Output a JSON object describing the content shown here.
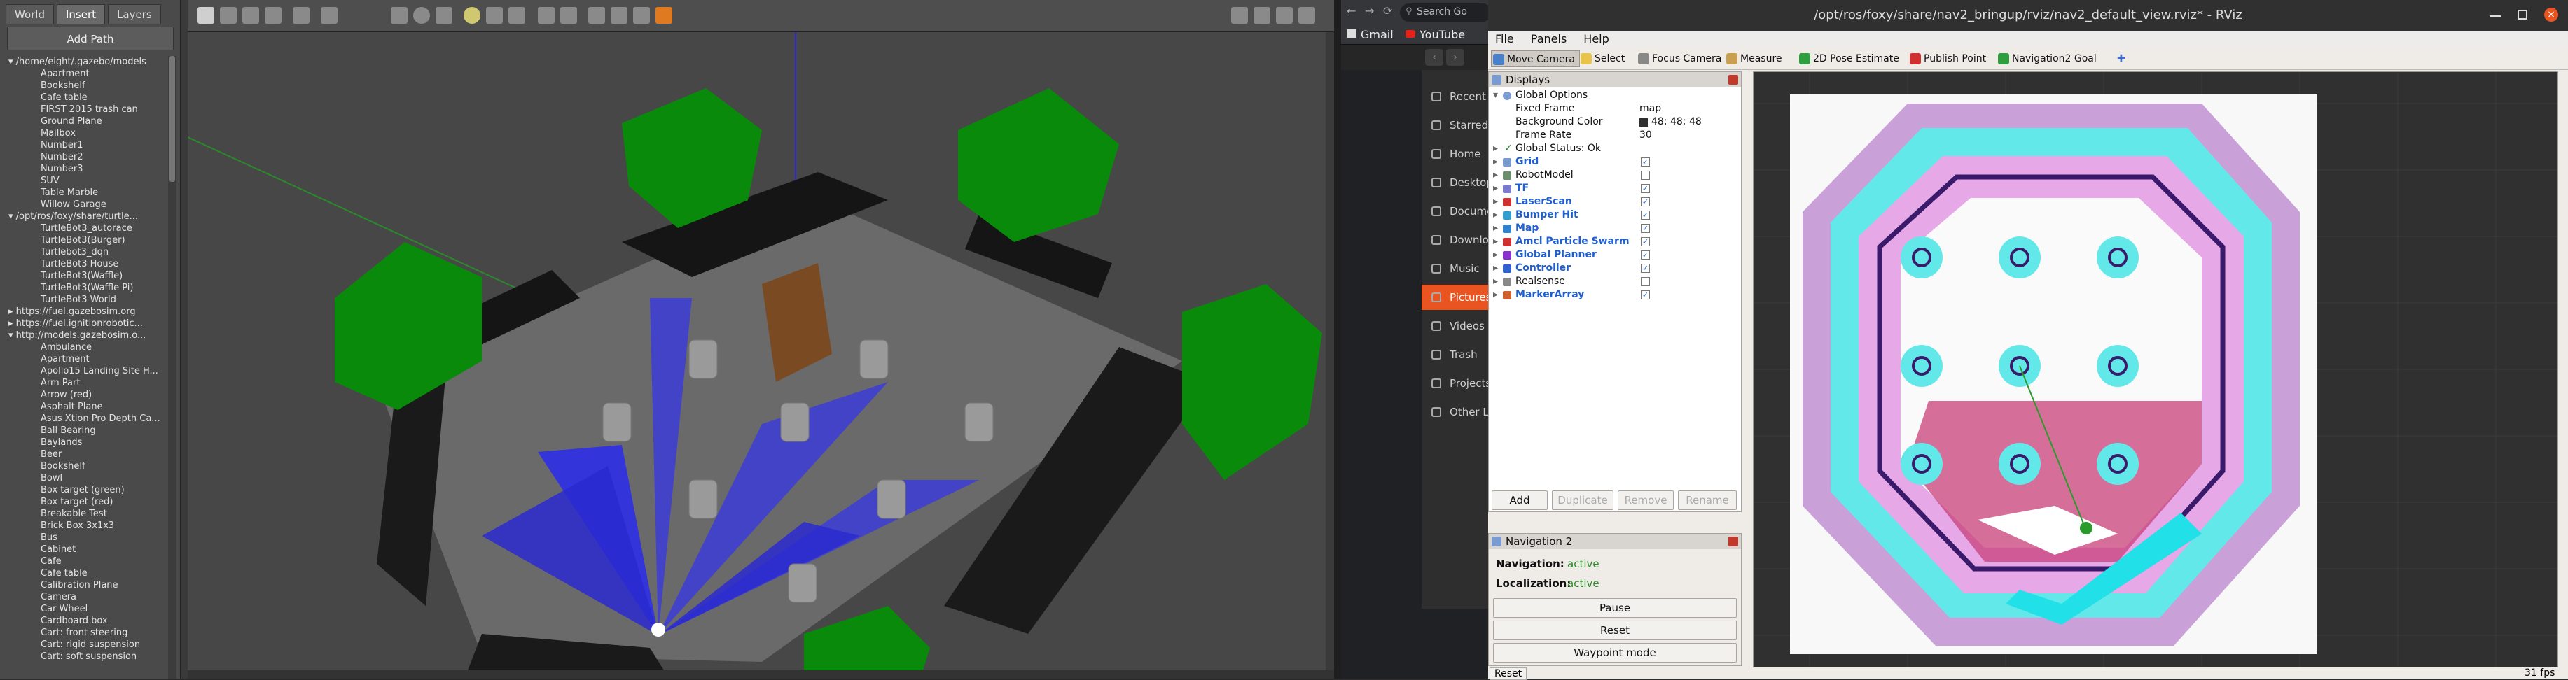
{
  "gazebo": {
    "tabs": [
      "World",
      "Insert",
      "Layers"
    ],
    "add_path": "Add Path",
    "tree": [
      {
        "label": "/home/eight/.gazebo/models",
        "level": 0,
        "expanded": true
      },
      {
        "label": "Apartment",
        "level": 1
      },
      {
        "label": "Bookshelf",
        "level": 1
      },
      {
        "label": "Cafe table",
        "level": 1
      },
      {
        "label": "FIRST 2015 trash can",
        "level": 1
      },
      {
        "label": "Ground Plane",
        "level": 1
      },
      {
        "label": "Mailbox",
        "level": 1
      },
      {
        "label": "Number1",
        "level": 1
      },
      {
        "label": "Number2",
        "level": 1
      },
      {
        "label": "Number3",
        "level": 1
      },
      {
        "label": "SUV",
        "level": 1
      },
      {
        "label": "Table Marble",
        "level": 1
      },
      {
        "label": "Willow Garage",
        "level": 1
      },
      {
        "label": "/opt/ros/foxy/share/turtle...",
        "level": 0,
        "expanded": true
      },
      {
        "label": "TurtleBot3_autorace",
        "level": 1
      },
      {
        "label": "TurtleBot3(Burger)",
        "level": 1
      },
      {
        "label": "Turtlebot3_dqn",
        "level": 1
      },
      {
        "label": "TurtleBot3 House",
        "level": 1
      },
      {
        "label": "TurtleBot3(Waffle)",
        "level": 1
      },
      {
        "label": "TurtleBot3(Waffle Pi)",
        "level": 1
      },
      {
        "label": "TurtleBot3 World",
        "level": 1
      },
      {
        "label": "https://fuel.gazebosim.org",
        "level": 0,
        "expanded": false
      },
      {
        "label": "https://fuel.ignitionrobotic...",
        "level": 0,
        "expanded": false
      },
      {
        "label": "http://models.gazebosim.o...",
        "level": 0,
        "expanded": true
      },
      {
        "label": "Ambulance",
        "level": 1
      },
      {
        "label": "Apartment",
        "level": 1
      },
      {
        "label": "Apollo15 Landing Site H...",
        "level": 1
      },
      {
        "label": "Arm Part",
        "level": 1
      },
      {
        "label": "Arrow (red)",
        "level": 1
      },
      {
        "label": "Asphalt Plane",
        "level": 1
      },
      {
        "label": "Asus Xtion Pro Depth Ca...",
        "level": 1
      },
      {
        "label": "Ball Bearing",
        "level": 1
      },
      {
        "label": "Baylands",
        "level": 1
      },
      {
        "label": "Beer",
        "level": 1
      },
      {
        "label": "Bookshelf",
        "level": 1
      },
      {
        "label": "Bowl",
        "level": 1
      },
      {
        "label": "Box target (green)",
        "level": 1
      },
      {
        "label": "Box target (red)",
        "level": 1
      },
      {
        "label": "Breakable Test",
        "level": 1
      },
      {
        "label": "Brick Box 3x1x3",
        "level": 1
      },
      {
        "label": "Bus",
        "level": 1
      },
      {
        "label": "Cabinet",
        "level": 1
      },
      {
        "label": "Cafe",
        "level": 1
      },
      {
        "label": "Cafe table",
        "level": 1
      },
      {
        "label": "Calibration Plane",
        "level": 1
      },
      {
        "label": "Camera",
        "level": 1
      },
      {
        "label": "Car Wheel",
        "level": 1
      },
      {
        "label": "Cardboard box",
        "level": 1
      },
      {
        "label": "Cart: front steering",
        "level": 1
      },
      {
        "label": "Cart: rigid suspension",
        "level": 1
      },
      {
        "label": "Cart: soft suspension",
        "level": 1
      }
    ]
  },
  "browser": {
    "address": "Search Go",
    "bookmarks": [
      "Gmail",
      "YouTube"
    ],
    "sidebar": [
      {
        "label": "Recent",
        "selected": false
      },
      {
        "label": "Starred",
        "selected": false
      },
      {
        "label": "Home",
        "selected": false
      },
      {
        "label": "Desktop",
        "selected": false
      },
      {
        "label": "Documents",
        "selected": false
      },
      {
        "label": "Downloads",
        "selected": false
      },
      {
        "label": "Music",
        "selected": false
      },
      {
        "label": "Pictures",
        "selected": true
      },
      {
        "label": "Videos",
        "selected": false
      },
      {
        "label": "Trash",
        "selected": false
      },
      {
        "label": "Projects",
        "selected": false
      },
      {
        "label": "Other Locations",
        "selected": false
      }
    ]
  },
  "rviz": {
    "title": "/opt/ros/foxy/share/nav2_bringup/rviz/nav2_default_view.rviz* - RViz",
    "menu": [
      "File",
      "Panels",
      "Help"
    ],
    "tools": [
      {
        "label": "Move Camera",
        "active": true,
        "color": "#4a7fc9"
      },
      {
        "label": "Select",
        "active": false,
        "color": "#e8c44a"
      },
      {
        "label": "Focus Camera",
        "active": false,
        "color": "#888888"
      },
      {
        "label": "Measure",
        "active": false,
        "color": "#c8a050"
      },
      {
        "label": "2D Pose Estimate",
        "active": false,
        "color": "#2e9e3e"
      },
      {
        "label": "Publish Point",
        "active": false,
        "color": "#d03030"
      },
      {
        "label": "Navigation2 Goal",
        "active": false,
        "color": "#2e9e3e"
      }
    ],
    "displays": {
      "title": "Displays",
      "global_options": "Global Options",
      "fixed_frame_label": "Fixed Frame",
      "fixed_frame_value": "map",
      "bg_color_label": "Background Color",
      "bg_color_value": "48; 48; 48",
      "frame_rate_label": "Frame Rate",
      "frame_rate_value": "30",
      "global_status": "Global Status: Ok",
      "items": [
        {
          "label": "Grid",
          "checked": true,
          "highlight": true,
          "color": "#7a9bd1"
        },
        {
          "label": "RobotModel",
          "checked": false,
          "highlight": false,
          "color": "#6b8e6b"
        },
        {
          "label": "TF",
          "checked": true,
          "highlight": true,
          "color": "#7a7ad1"
        },
        {
          "label": "LaserScan",
          "checked": true,
          "highlight": true,
          "color": "#d03030"
        },
        {
          "label": "Bumper Hit",
          "checked": true,
          "highlight": true,
          "color": "#30a0d0"
        },
        {
          "label": "Map",
          "checked": true,
          "highlight": true,
          "color": "#3080d0"
        },
        {
          "label": "Amcl Particle Swarm",
          "checked": true,
          "highlight": true,
          "color": "#d03030"
        },
        {
          "label": "Global Planner",
          "checked": true,
          "highlight": true,
          "color": "#8a30d0"
        },
        {
          "label": "Controller",
          "checked": true,
          "highlight": true,
          "color": "#3060d0"
        },
        {
          "label": "Realsense",
          "checked": false,
          "highlight": false,
          "color": "#888888"
        },
        {
          "label": "MarkerArray",
          "checked": true,
          "highlight": true,
          "color": "#d06030"
        }
      ],
      "buttons": {
        "add": "Add",
        "duplicate": "Duplicate",
        "remove": "Remove",
        "rename": "Rename"
      }
    },
    "nav2": {
      "title": "Navigation 2",
      "navigation_label": "Navigation:",
      "navigation_value": "active",
      "localization_label": "Localization:",
      "localization_value": "active",
      "pause": "Pause",
      "reset": "Reset",
      "waypoint": "Waypoint mode"
    },
    "status": {
      "reset": "Reset",
      "fps": "31 fps"
    }
  }
}
